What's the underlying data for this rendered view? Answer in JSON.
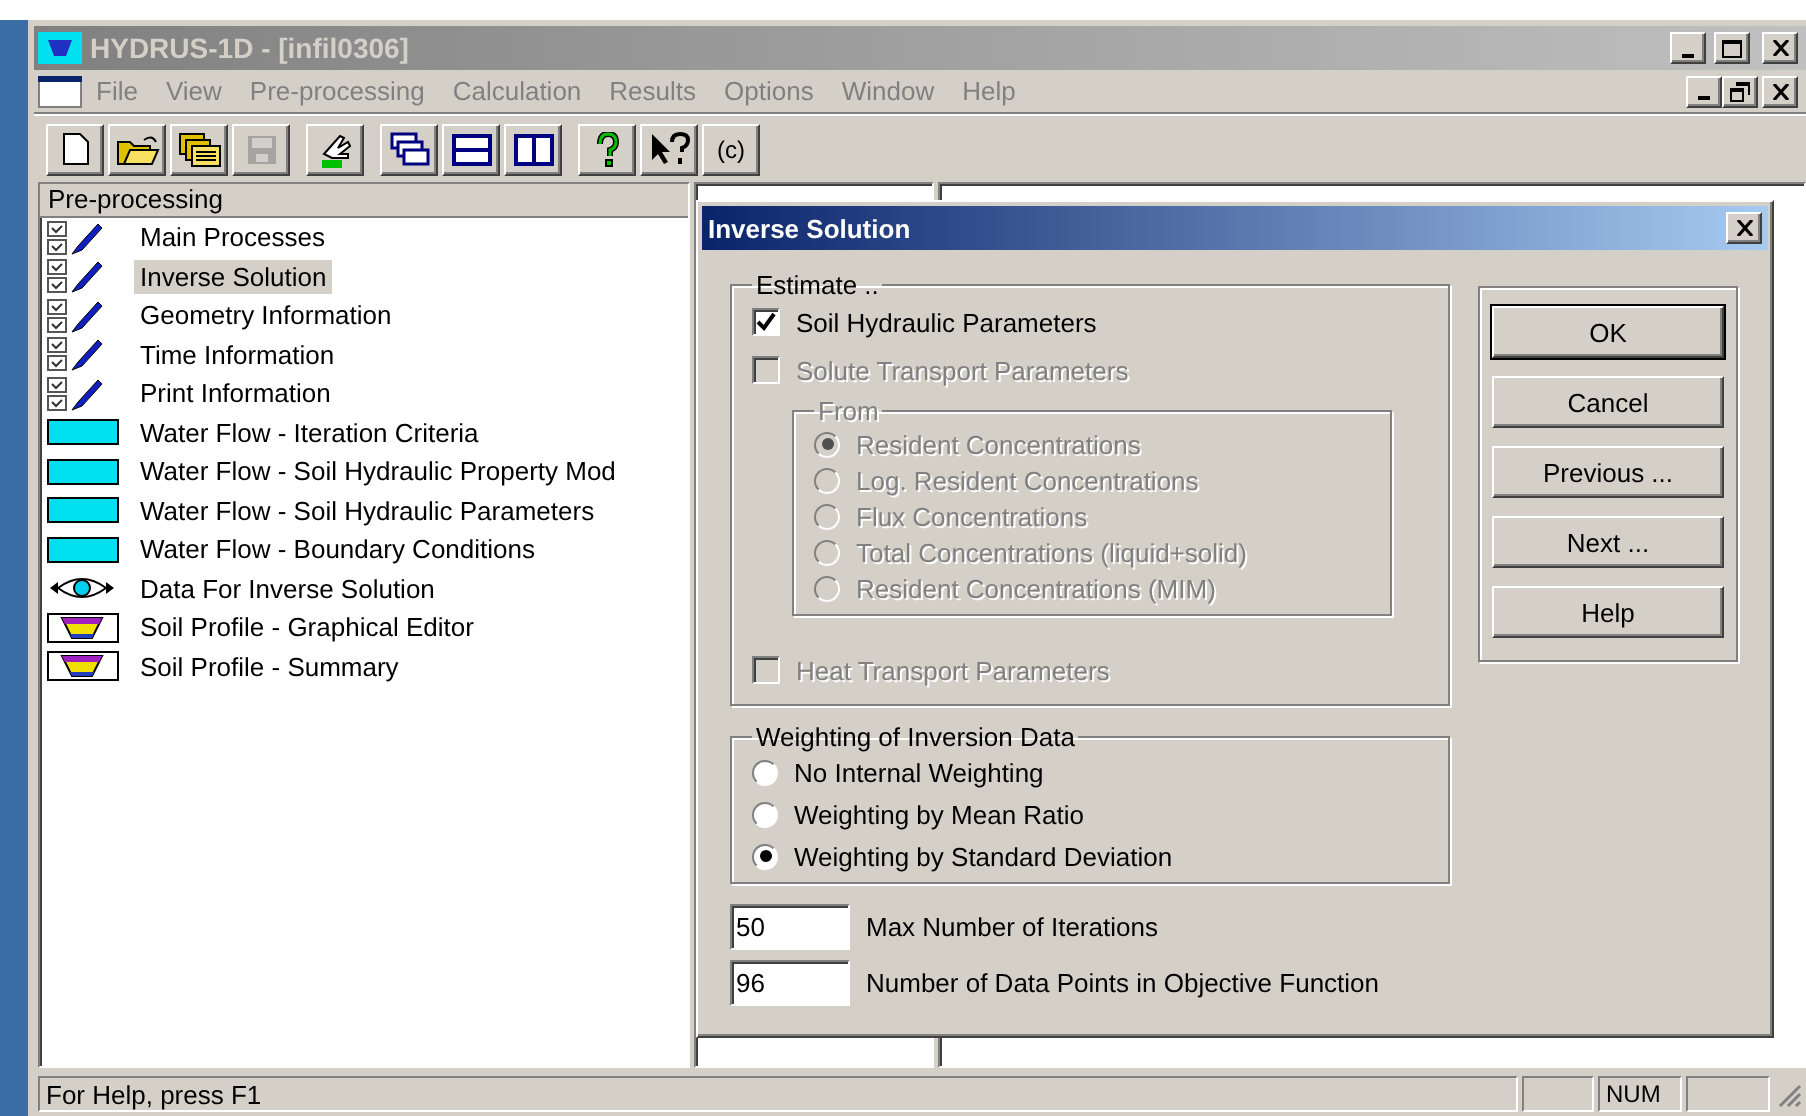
{
  "window": {
    "title": "HYDRUS-1D - [infil0306]"
  },
  "menu": [
    "File",
    "View",
    "Pre-processing",
    "Calculation",
    "Results",
    "Options",
    "Window",
    "Help"
  ],
  "toolbar": [
    {
      "buttons": [
        {
          "kind": "new",
          "disabled": false
        },
        {
          "kind": "open",
          "disabled": false
        },
        {
          "kind": "files",
          "disabled": false
        },
        {
          "kind": "save",
          "disabled": true
        }
      ]
    },
    {
      "buttons": [
        {
          "kind": "hand",
          "disabled": false
        }
      ]
    },
    {
      "buttons": [
        {
          "kind": "cascade",
          "disabled": false
        },
        {
          "kind": "rows",
          "disabled": false
        },
        {
          "kind": "columns",
          "disabled": false
        }
      ]
    },
    {
      "buttons": [
        {
          "kind": "help",
          "disabled": false
        },
        {
          "kind": "pointer-help",
          "disabled": false
        },
        {
          "kind": "text",
          "label": "(c)",
          "disabled": false
        }
      ]
    }
  ],
  "tree": {
    "title": "Pre-processing",
    "items": [
      {
        "label": "Main Processes",
        "kind": "pencil",
        "selected": false
      },
      {
        "label": "Inverse Solution",
        "kind": "pencil",
        "selected": true
      },
      {
        "label": "Geometry Information",
        "kind": "pencil",
        "selected": false
      },
      {
        "label": "Time Information",
        "kind": "pencil",
        "selected": false
      },
      {
        "label": "Print Information",
        "kind": "pencil",
        "selected": false
      },
      {
        "label": "Water Flow - Iteration Criteria",
        "kind": "water",
        "selected": false
      },
      {
        "label": "Water Flow - Soil Hydraulic Property Mod",
        "kind": "water",
        "selected": false
      },
      {
        "label": "Water Flow - Soil Hydraulic Parameters",
        "kind": "water",
        "selected": false
      },
      {
        "label": "Water Flow - Boundary Conditions",
        "kind": "water",
        "selected": false
      },
      {
        "label": "Data For Inverse Solution",
        "kind": "eye",
        "selected": false
      },
      {
        "label": "Soil Profile - Graphical Editor",
        "kind": "profile",
        "selected": false
      },
      {
        "label": "Soil Profile - Summary",
        "kind": "profile",
        "selected": false
      }
    ]
  },
  "dialog": {
    "title": "Inverse Solution",
    "estimate": {
      "label": "Estimate ..",
      "soil": {
        "label": "Soil Hydraulic Parameters",
        "checked": true,
        "disabled": false
      },
      "solute": {
        "label": "Solute Transport Parameters",
        "checked": false,
        "disabled": true
      },
      "from": {
        "label": "From",
        "options": [
          {
            "label": "Resident Concentrations",
            "selected": true,
            "disabled": true
          },
          {
            "label": "Log. Resident Concentrations",
            "selected": false,
            "disabled": true
          },
          {
            "label": "Flux Concentrations",
            "selected": false,
            "disabled": true
          },
          {
            "label": "Total Concentrations (liquid+solid)",
            "selected": false,
            "disabled": true
          },
          {
            "label": "Resident Concentrations (MIM)",
            "selected": false,
            "disabled": true
          }
        ]
      },
      "heat": {
        "label": "Heat Transport Parameters",
        "checked": false,
        "disabled": true
      }
    },
    "weighting": {
      "label": "Weighting of Inversion Data",
      "options": [
        {
          "label": "No Internal Weighting",
          "selected": false,
          "disabled": false
        },
        {
          "label": "Weighting by Mean Ratio",
          "selected": false,
          "disabled": false
        },
        {
          "label": "Weighting by Standard Deviation",
          "selected": true,
          "disabled": false
        }
      ]
    },
    "fields": [
      {
        "value": "50",
        "label": "Max Number of Iterations"
      },
      {
        "value": "96",
        "label": "Number of Data Points in Objective Function"
      }
    ],
    "buttons": [
      {
        "label": "OK",
        "default": true
      },
      {
        "label": "Cancel",
        "default": false
      },
      {
        "label": "Previous ...",
        "default": false
      },
      {
        "label": "Next ...",
        "default": false
      },
      {
        "label": "Help",
        "default": false
      }
    ]
  },
  "status_bar": {
    "text": "For Help, press F1",
    "indicators": [
      "NUM"
    ]
  }
}
